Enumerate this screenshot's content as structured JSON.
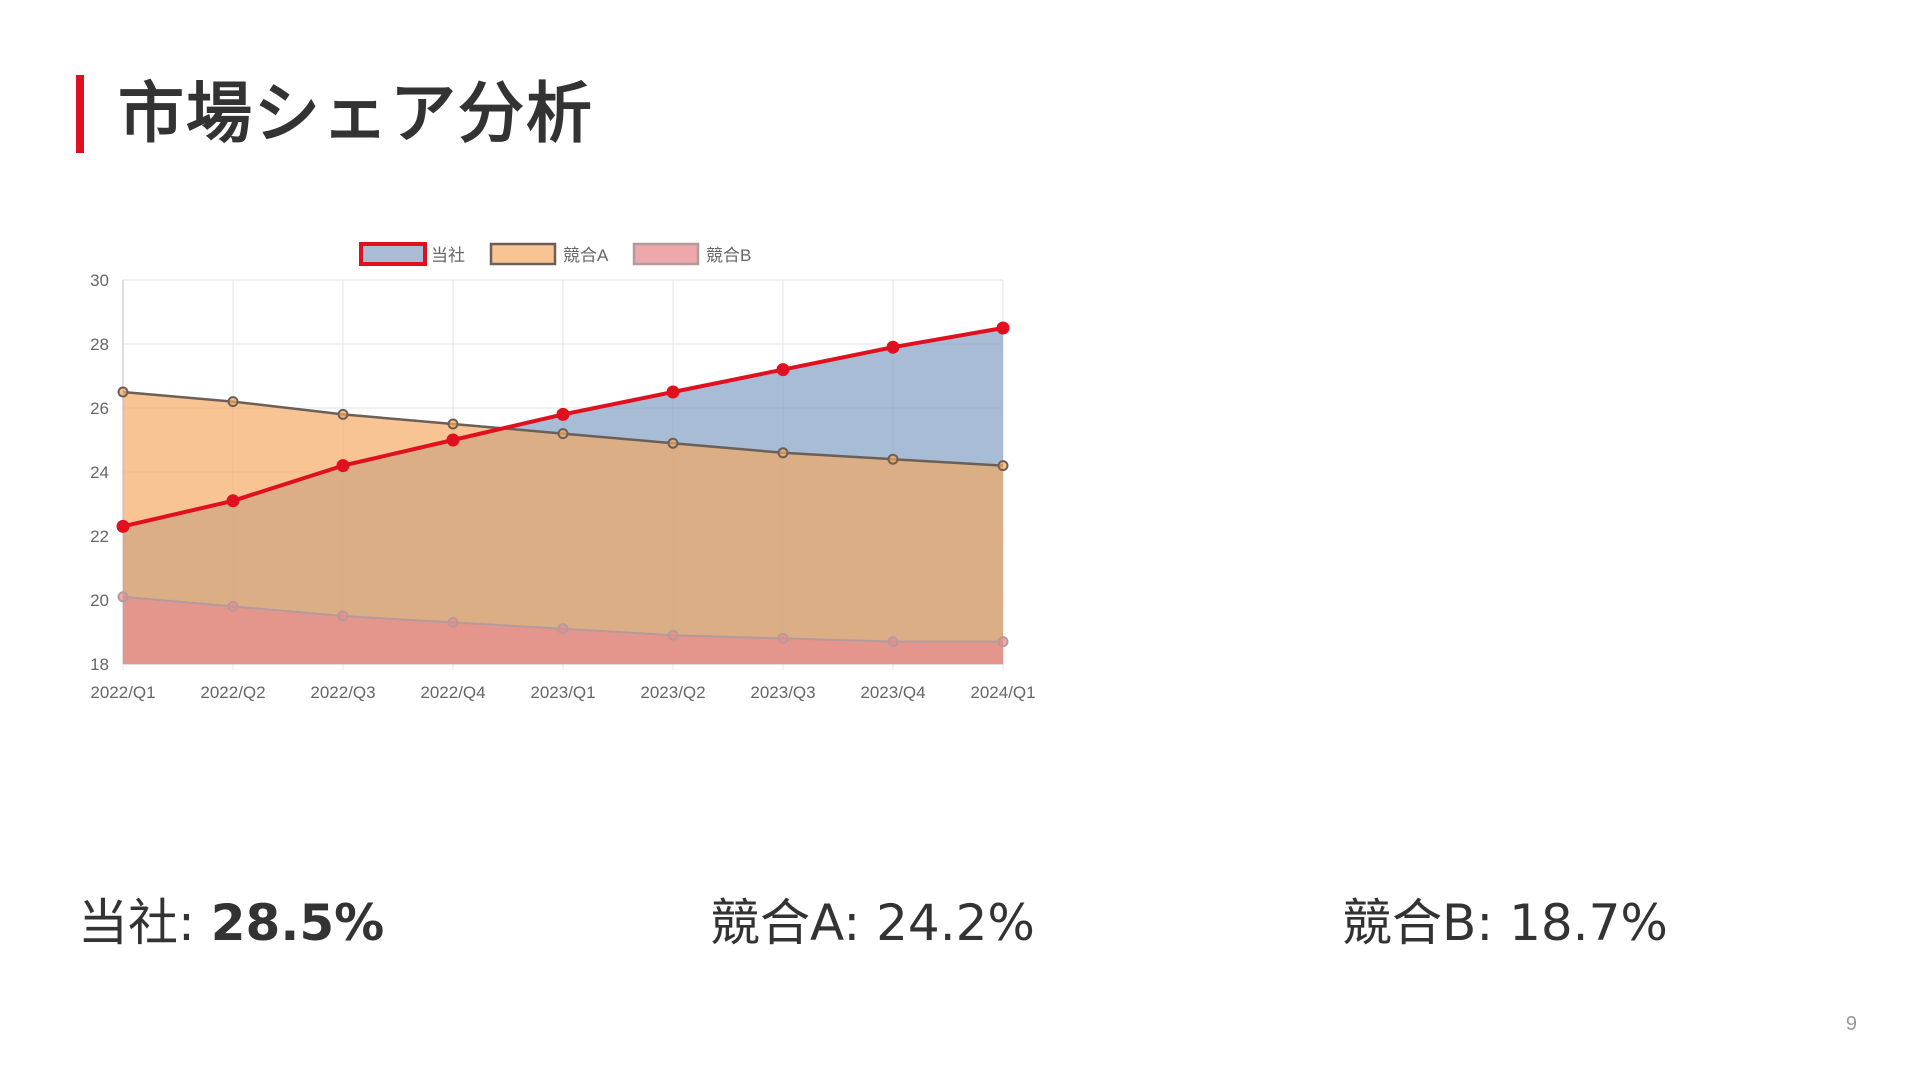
{
  "slide": {
    "title": "市場シェア分析",
    "page_number": "9",
    "accent_color": "#e0101e"
  },
  "stats": [
    {
      "label": "当社",
      "separator": ": ",
      "value": "28.5%",
      "bold": true
    },
    {
      "label": "競合A",
      "separator": ": ",
      "value": "24.2%",
      "bold": false
    },
    {
      "label": "競合B",
      "separator": ": ",
      "value": "18.7%",
      "bold": false
    }
  ],
  "chart_data": {
    "type": "area",
    "title": "",
    "xlabel": "",
    "ylabel": "",
    "categories": [
      "2022/Q1",
      "2022/Q2",
      "2022/Q3",
      "2022/Q4",
      "2023/Q1",
      "2023/Q2",
      "2023/Q3",
      "2023/Q4",
      "2024/Q1"
    ],
    "ylim": [
      18,
      30
    ],
    "yticks": [
      18,
      20,
      22,
      24,
      26,
      28,
      30
    ],
    "grid": true,
    "legend_position": "top-center",
    "series": [
      {
        "name": "当社",
        "values": [
          22.3,
          23.1,
          24.2,
          25.0,
          25.8,
          26.5,
          27.2,
          27.9,
          28.5
        ],
        "line_color": "#e0101e",
        "fill_color": "#7f9cc3"
      },
      {
        "name": "競合A",
        "values": [
          26.5,
          26.2,
          25.8,
          25.5,
          25.2,
          24.9,
          24.6,
          24.4,
          24.2
        ],
        "line_color": "#6b6058",
        "fill_color": "#f4a860"
      },
      {
        "name": "競合B",
        "values": [
          20.1,
          19.8,
          19.5,
          19.3,
          19.1,
          18.9,
          18.8,
          18.7,
          18.7
        ],
        "line_color": "#b59a9c",
        "fill_color": "#e88a8f"
      }
    ]
  }
}
